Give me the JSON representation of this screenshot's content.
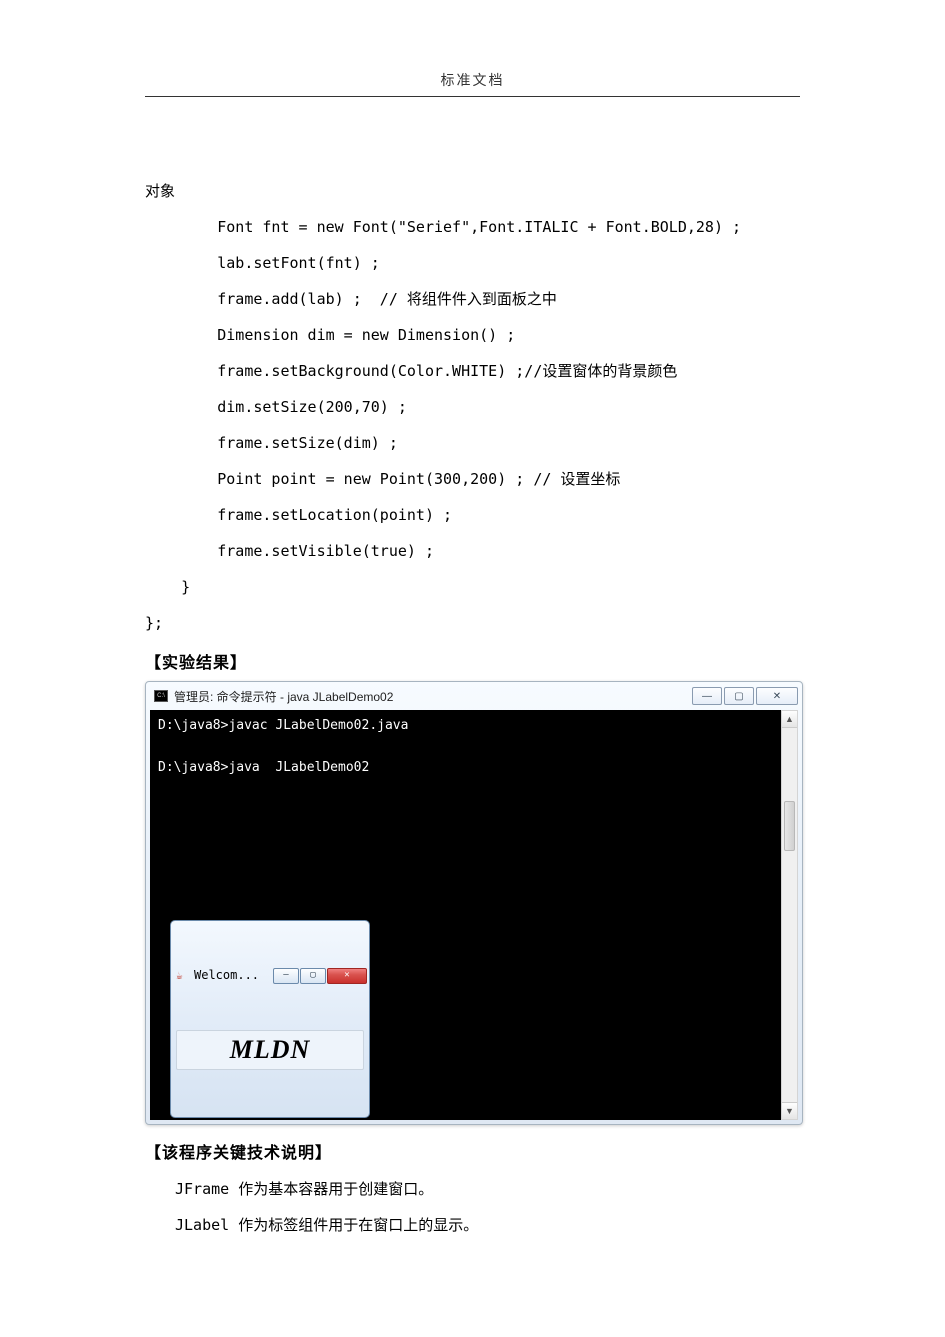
{
  "header": {
    "title": "标准文档"
  },
  "code": {
    "line0": "对象",
    "line1": "        Font fnt = new Font(\"Serief\",Font.ITALIC + Font.BOLD,28) ;",
    "line2": "        lab.setFont(fnt) ;",
    "line3": "        frame.add(lab) ;  // 将组件件入到面板之中",
    "line4": "        Dimension dim = new Dimension() ;",
    "line5": "        frame.setBackground(Color.WHITE) ;//设置窗体的背景颜色",
    "line6": "        dim.setSize(200,70) ;",
    "line7": "        frame.setSize(dim) ;",
    "line8": "        Point point = new Point(300,200) ; // 设置坐标",
    "line9": "        frame.setLocation(point) ;",
    "line10": "        frame.setVisible(true) ;",
    "line11": "    }",
    "line12": "};"
  },
  "sections": {
    "result_title": "【实验结果】",
    "explain_title": "【该程序关键技术说明】",
    "explain_p1": "JFrame 作为基本容器用于创建窗口。",
    "explain_p2": "JLabel 作为标签组件用于在窗口上的显示。"
  },
  "cmd": {
    "title": "管理员: 命令提示符 - java  JLabelDemo02",
    "line1": "D:\\java8>javac JLabelDemo02.java",
    "line2": "D:\\java8>java  JLabelDemo02",
    "controls": {
      "min": "—",
      "max": "▢",
      "close": "✕"
    },
    "scroll": {
      "up": "▲",
      "down": "▼"
    }
  },
  "swing": {
    "title": "Welcom...",
    "label": "MLDN",
    "controls": {
      "min": "—",
      "max": "▢",
      "close": "✕"
    }
  }
}
